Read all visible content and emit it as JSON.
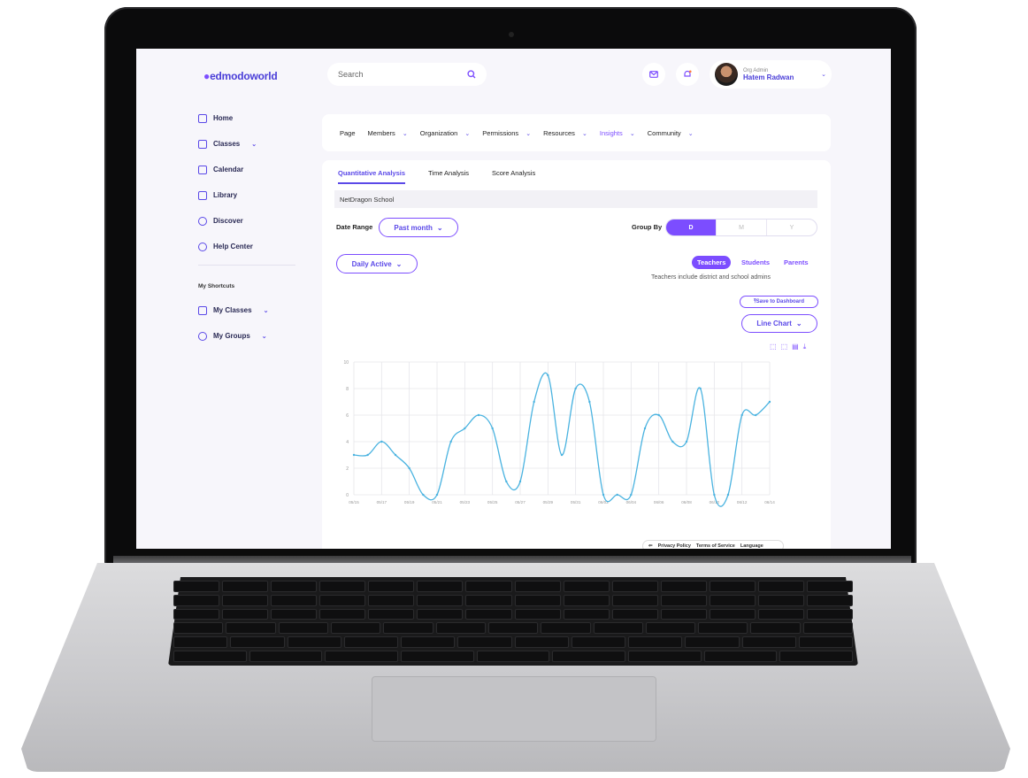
{
  "app": {
    "logo": "edmodoworld"
  },
  "search": {
    "placeholder": "Search"
  },
  "profile": {
    "role": "Org Admin",
    "name": "Hatem Radwan"
  },
  "sidebar": {
    "items": [
      {
        "label": "Home",
        "icon": "grid-icon"
      },
      {
        "label": "Classes",
        "icon": "monitor-icon",
        "dropdown": true
      },
      {
        "label": "Calendar",
        "icon": "calendar-icon"
      },
      {
        "label": "Library",
        "icon": "book-icon"
      },
      {
        "label": "Discover",
        "icon": "compass-icon"
      },
      {
        "label": "Help Center",
        "icon": "help-icon"
      }
    ],
    "shortcuts_heading": "My Shortcuts",
    "shortcuts": [
      {
        "label": "My Classes",
        "icon": "monitor-icon"
      },
      {
        "label": "My Groups",
        "icon": "groups-icon"
      }
    ]
  },
  "menu": {
    "items": [
      "Page",
      "Members",
      "Organization",
      "Permissions",
      "Resources",
      "Insights",
      "Community"
    ],
    "active": "Insights"
  },
  "tabs": {
    "items": [
      "Quantitative Analysis",
      "Time Analysis",
      "Score Analysis"
    ],
    "active": "Quantitative Analysis"
  },
  "school": "NetDragon School",
  "filters": {
    "date_range_label": "Date Range",
    "date_range_value": "Past month",
    "group_by_label": "Group By",
    "group_by_options": [
      "D",
      "M",
      "Y"
    ],
    "group_by_active": "D",
    "metric": "Daily Active"
  },
  "audience": {
    "options": [
      "Teachers",
      "Students",
      "Parents"
    ],
    "active": "Teachers",
    "note": "Teachers include district and school admins"
  },
  "actions": {
    "save": "Save to Dashboard",
    "chart_type": "Line Chart"
  },
  "footer": {
    "links": [
      "Privacy Policy",
      "Terms of Service",
      "Language"
    ]
  },
  "colors": {
    "accent": "#7c4dff",
    "line": "#4ab3e0"
  },
  "chart_data": {
    "type": "line",
    "x": [
      "05/15",
      "05/16",
      "05/17",
      "05/18",
      "05/19",
      "05/20",
      "05/21",
      "05/22",
      "05/23",
      "05/24",
      "05/25",
      "05/26",
      "05/27",
      "05/28",
      "05/29",
      "05/30",
      "05/31",
      "06/01",
      "06/02",
      "06/03",
      "06/04",
      "06/05",
      "06/06",
      "06/07",
      "06/08",
      "06/09",
      "06/10",
      "06/11",
      "06/12",
      "06/13",
      "06/14"
    ],
    "tick_labels": [
      "05/15",
      "05/17",
      "05/19",
      "05/21",
      "05/23",
      "05/25",
      "05/27",
      "05/29",
      "05/31",
      "06/02",
      "06/04",
      "06/06",
      "06/08",
      "06/10",
      "06/12",
      "06/14"
    ],
    "series": [
      {
        "values": [
          3,
          3,
          4,
          3,
          2,
          0,
          0,
          4,
          5,
          6,
          5,
          1,
          1,
          7,
          9,
          3,
          8,
          7,
          0,
          0,
          0,
          5,
          6,
          4,
          4,
          8,
          0,
          0,
          6,
          6,
          7
        ]
      }
    ],
    "ylim": [
      0,
      10
    ],
    "yticks": [
      0,
      2,
      4,
      6,
      8,
      10
    ],
    "grid": true
  }
}
